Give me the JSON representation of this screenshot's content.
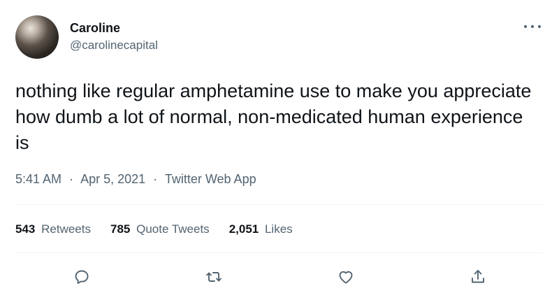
{
  "user": {
    "display_name": "Caroline",
    "handle": "@carolinecapital"
  },
  "tweet": {
    "text": "nothing like regular amphetamine use to make you appreciate how dumb a lot of normal, non-medicated human experience is",
    "time": "5:41 AM",
    "date": "Apr 5, 2021",
    "source": "Twitter Web App",
    "separator": "·"
  },
  "stats": {
    "retweets_count": "543",
    "retweets_label": "Retweets",
    "quote_count": "785",
    "quote_label": "Quote Tweets",
    "likes_count": "2,051",
    "likes_label": "Likes"
  },
  "icons": {
    "more": "more-icon",
    "reply": "reply-icon",
    "retweet": "retweet-icon",
    "like": "heart-icon",
    "share": "share-icon"
  },
  "colors": {
    "text_primary": "#0f1419",
    "text_secondary": "#536471",
    "divider": "#eff3f4"
  }
}
